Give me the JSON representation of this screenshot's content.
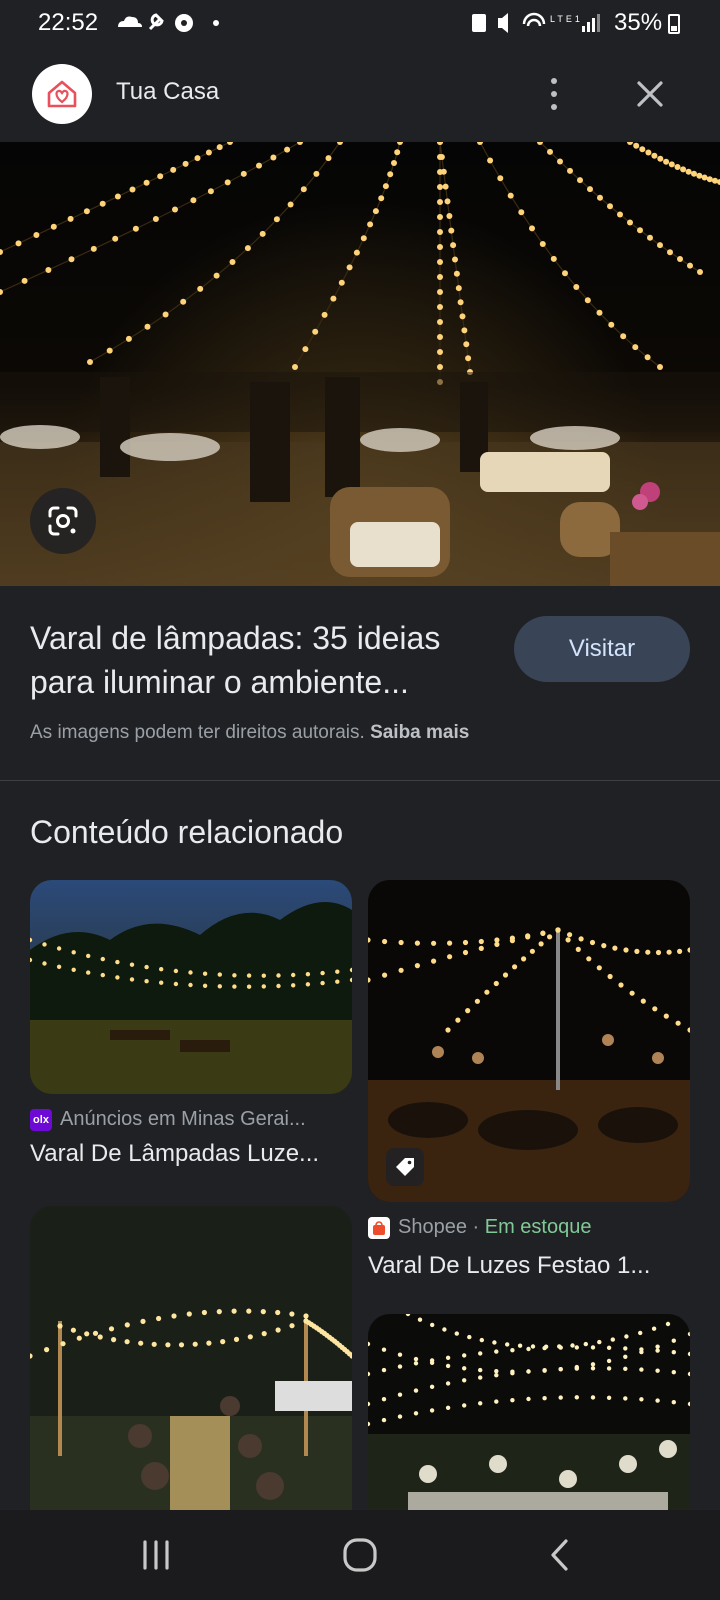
{
  "status_bar": {
    "time": "22:52",
    "battery": "35%",
    "battery_level": 0.35,
    "network": "LTE1"
  },
  "header": {
    "site_name": "Tua Casa",
    "icons": [
      "home-heart-icon",
      "more-vert-icon",
      "close-icon"
    ]
  },
  "hero": {
    "lens_icon": "google-lens-icon"
  },
  "result": {
    "title_line1": "Varal de lâmpadas: 35 ideias",
    "title_line2": "para iluminar o ambiente...",
    "visit_label": "Visitar",
    "copyright_text": "As imagens podem ter direitos autorais.",
    "learn_more": "Saiba mais"
  },
  "related": {
    "heading": "Conteúdo relacionado",
    "items": [
      {
        "source": "Anúncios em Minas Gerai...",
        "title": "Varal De Lâmpadas Luze...",
        "favicon": "olx"
      },
      {
        "source": "Shopee",
        "stock": "Em estoque",
        "title": "Varal De Luzes Festao 1...",
        "favicon": "shopee",
        "tag_icon": "price-tag-icon"
      },
      {
        "source": "",
        "title": ""
      },
      {
        "source": "",
        "title": ""
      }
    ]
  },
  "colors": {
    "background": "#202124",
    "visit_button": "#394457",
    "in_stock": "#81c995"
  },
  "navbar": {
    "icons": [
      "recent-apps-icon",
      "home-icon",
      "back-icon"
    ]
  }
}
